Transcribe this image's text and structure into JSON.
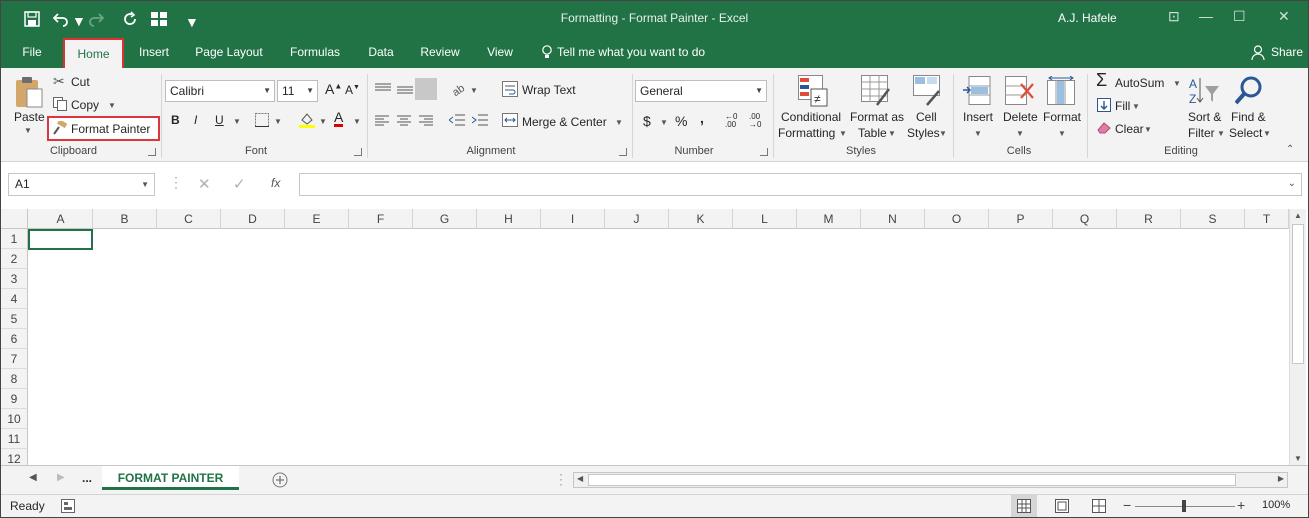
{
  "window": {
    "title": "Formatting - Format Painter  -  Excel",
    "user": "A.J. Hafele"
  },
  "menu": {
    "tabs": [
      "File",
      "Home",
      "Insert",
      "Page Layout",
      "Formulas",
      "Data",
      "Review",
      "View"
    ],
    "tell_me": "Tell me what you want to do",
    "share": "Share"
  },
  "ribbon": {
    "clipboard": {
      "paste": "Paste",
      "cut": "Cut",
      "copy": "Copy",
      "format_painter": "Format Painter",
      "label": "Clipboard"
    },
    "font": {
      "font_name": "Calibri",
      "font_size": "11",
      "bold": "B",
      "italic": "I",
      "underline": "U",
      "label": "Font"
    },
    "alignment": {
      "wrap_text": "Wrap Text",
      "merge_center": "Merge & Center",
      "label": "Alignment"
    },
    "number": {
      "format": "General",
      "currency": "$",
      "percent": "%",
      "comma": ",",
      "label": "Number"
    },
    "styles": {
      "conditional_1": "Conditional",
      "conditional_2": "Formatting",
      "format_as_1": "Format as",
      "format_as_2": "Table",
      "cell_styles_1": "Cell",
      "cell_styles_2": "Styles",
      "label": "Styles"
    },
    "cells": {
      "insert": "Insert",
      "delete": "Delete",
      "format": "Format",
      "label": "Cells"
    },
    "editing": {
      "autosum": "AutoSum",
      "fill": "Fill",
      "clear": "Clear",
      "sort_1": "Sort &",
      "sort_2": "Filter",
      "find_1": "Find &",
      "find_2": "Select",
      "label": "Editing"
    }
  },
  "formula_bar": {
    "name_box": "A1",
    "fx": "fx",
    "formula": ""
  },
  "grid": {
    "columns": [
      "A",
      "B",
      "C",
      "D",
      "E",
      "F",
      "G",
      "H",
      "I",
      "J",
      "K",
      "L",
      "M",
      "N",
      "O",
      "P",
      "Q",
      "R",
      "S",
      "T"
    ],
    "rows": [
      "1",
      "2",
      "3",
      "4",
      "5",
      "6",
      "7",
      "8",
      "9",
      "10",
      "11",
      "12"
    ]
  },
  "sheets": {
    "ellipsis": "...",
    "active": "FORMAT PAINTER"
  },
  "status": {
    "ready": "Ready",
    "zoom": "100%"
  },
  "colors": {
    "brand": "#217346",
    "highlight_border": "#e03131"
  }
}
